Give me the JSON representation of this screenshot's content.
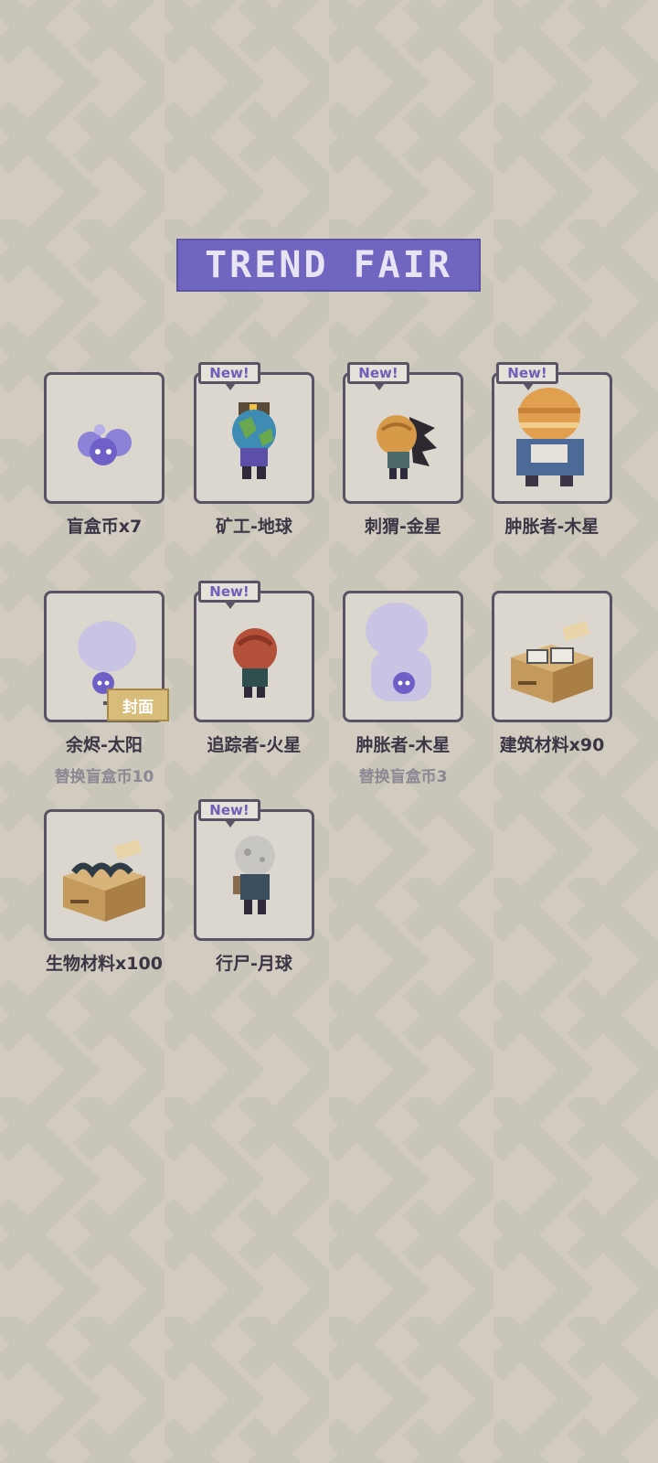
{
  "title": "TREND FAIR",
  "new_label": "New!",
  "cover_label": "封面",
  "items": [
    {
      "name": "盲盒币x7",
      "sub": "",
      "new": false
    },
    {
      "name": "矿工-地球",
      "sub": "",
      "new": true
    },
    {
      "name": "刺猬-金星",
      "sub": "",
      "new": true
    },
    {
      "name": "肿胀者-木星",
      "sub": "",
      "new": true
    },
    {
      "name": "余烬-太阳",
      "sub": "替换盲盒币10",
      "new": false
    },
    {
      "name": "追踪者-火星",
      "sub": "",
      "new": true
    },
    {
      "name": "肿胀者-木星",
      "sub": "替换盲盒币3",
      "new": false
    },
    {
      "name": "建筑材料x90",
      "sub": "",
      "new": false
    },
    {
      "name": "生物材料x100",
      "sub": "",
      "new": false
    },
    {
      "name": "行尸-月球",
      "sub": "",
      "new": true
    }
  ],
  "colors": {
    "background": "#d1cbc0",
    "banner": "#7066bf",
    "frame_border": "#5a5366",
    "accent_purple": "#6e5fb8"
  }
}
